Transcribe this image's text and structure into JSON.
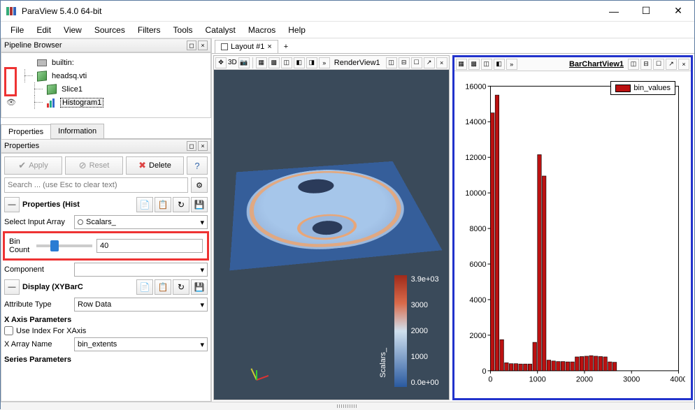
{
  "app": {
    "title": "ParaView 5.4.0 64-bit"
  },
  "menu": [
    "File",
    "Edit",
    "View",
    "Sources",
    "Filters",
    "Tools",
    "Catalyst",
    "Macros",
    "Help"
  ],
  "pipeline": {
    "title": "Pipeline Browser",
    "items": [
      {
        "label": "builtin:",
        "type": "server",
        "eye": ""
      },
      {
        "label": "headsq.vti",
        "type": "cube",
        "eye": ""
      },
      {
        "label": "Slice1",
        "type": "cube",
        "eye": ""
      },
      {
        "label": "Histogram1",
        "type": "hist",
        "eye": "👁",
        "selected": true
      }
    ]
  },
  "tabs": {
    "properties": "Properties",
    "information": "Information"
  },
  "properties": {
    "panel_title": "Properties",
    "apply": "Apply",
    "reset": "Reset",
    "delete": "Delete",
    "search_placeholder": "Search ... (use Esc to clear text)",
    "section_props": "Properties (Hist",
    "select_input_array_label": "Select Input Array",
    "select_input_array_value": "Scalars_",
    "bin_count_label": "Bin Count",
    "bin_count_value": "40",
    "component_label": "Component",
    "section_display": "Display (XYBarC",
    "attribute_type_label": "Attribute Type",
    "attribute_type_value": "Row Data",
    "x_axis_params": "X Axis Parameters",
    "use_index_xaxis": "Use Index For XAxis",
    "x_array_name_label": "X Array Name",
    "x_array_name_value": "bin_extents",
    "series_params": "Series Parameters"
  },
  "layout": {
    "tab_label": "Layout #1",
    "add": "+",
    "render_view": "RenderView1",
    "barchart_view": "BarChartView1",
    "mode_3d": "3D"
  },
  "render": {
    "legend_max": "3.9e+03",
    "legend_3000": "3000",
    "legend_2000": "2000",
    "legend_1000": "1000",
    "legend_min": "0.0e+00",
    "legend_title": "Scalars_"
  },
  "chart_data": {
    "type": "bar",
    "x": [
      0,
      100,
      200,
      300,
      400,
      500,
      600,
      700,
      800,
      900,
      1000,
      1100,
      1200,
      1300,
      1400,
      1500,
      1600,
      1700,
      1800,
      1900,
      2000,
      2100,
      2200,
      2300,
      2400,
      2500,
      2600,
      2700,
      2800,
      2900,
      3000,
      3100,
      3200,
      3300,
      3400,
      3500,
      3600,
      3700,
      3800,
      3900
    ],
    "values": [
      14500,
      15500,
      1750,
      450,
      400,
      400,
      380,
      380,
      380,
      1600,
      12150,
      10950,
      600,
      550,
      520,
      520,
      500,
      500,
      780,
      800,
      820,
      850,
      820,
      800,
      780,
      500,
      480,
      0,
      0,
      0,
      0,
      0,
      0,
      0,
      0,
      0,
      0,
      0,
      0,
      0
    ],
    "series_name": "bin_values",
    "xlim": [
      0,
      4000
    ],
    "ylim": [
      0,
      16000
    ],
    "xticks": [
      0,
      1000,
      2000,
      3000,
      4000
    ],
    "yticks": [
      0,
      2000,
      4000,
      6000,
      8000,
      10000,
      12000,
      14000,
      16000
    ]
  }
}
